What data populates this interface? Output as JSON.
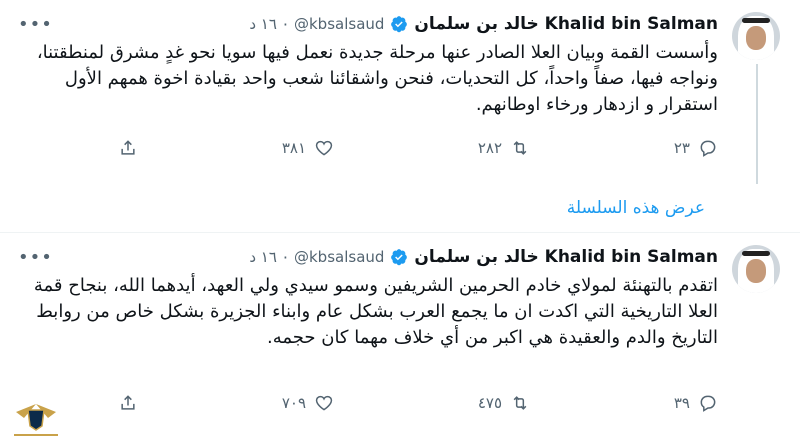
{
  "tweets": [
    {
      "name": "Khalid bin Salman خالد بن سلمان",
      "handle": "@kbsalsaud",
      "time": "١٦ د",
      "text": "وأسست القمة وبيان العلا الصادر عنها مرحلة جديدة نعمل فيها سويا نحو غدٍ مشرق لمنطقتنا، ونواجه فيها، صفاً واحداً، كل التحديات، فنحن واشقائنا شعب واحد بقيادة اخوة همهم الأول استقرار و ازدهار ورخاء اوطانهم.",
      "replies": "٢٣",
      "retweets": "٢٨٢",
      "likes": "٣٨١"
    },
    {
      "name": "Khalid bin Salman خالد بن سلمان",
      "handle": "@kbsalsaud",
      "time": "١٦ د",
      "text": "اتقدم بالتهنئة لمولاي خادم الحرمين الشريفين وسمو سيدي ولي العهد، أيدهما الله، بنجاح قمة العلا التاريخية التي اكدت ان ما يجمع العرب بشكل عام وابناء الجزيرة بشكل خاص من روابط التاريخ والدم والعقيدة هي اكبر من أي خلاف مهما كان حجمه.",
      "replies": "٣٩",
      "retweets": "٤٧٥",
      "likes": "٧٠٩"
    }
  ],
  "show_thread": "عرض هذه السلسلة",
  "colors": {
    "accent": "#1d9bf0",
    "muted": "#536471",
    "verified": "#1d9bf0"
  },
  "icons": [
    "verified-icon",
    "more-icon",
    "reply-icon",
    "retweet-icon",
    "like-icon",
    "share-icon"
  ]
}
